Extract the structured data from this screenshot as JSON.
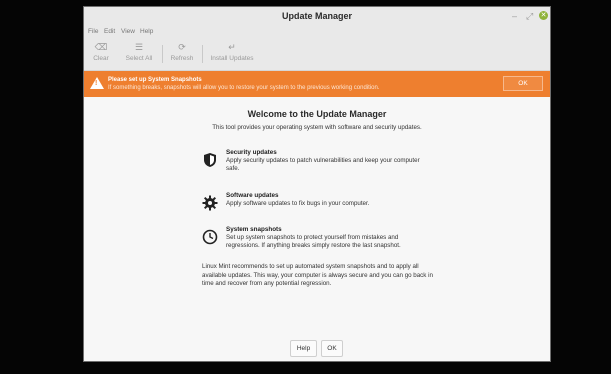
{
  "window": {
    "title": "Update Manager",
    "min_icon": "minimize-icon",
    "max_icon": "maximize-icon",
    "close_icon": "close-icon"
  },
  "menu": {
    "items": [
      "File",
      "Edit",
      "View",
      "Help"
    ]
  },
  "toolbar": {
    "clear": "Clear",
    "select_all": "Select All",
    "refresh": "Refresh",
    "install": "Install Updates"
  },
  "banner": {
    "title": "Please set up System Snapshots",
    "description": "If something breaks, snapshots will allow you to restore your system to the previous working condition.",
    "ok": "OK",
    "color": "#ee7f2f"
  },
  "welcome": {
    "title": "Welcome to the Update Manager",
    "subtitle": "This tool provides your operating system with software and security updates."
  },
  "features": [
    {
      "icon": "shield-icon",
      "title": "Security updates",
      "description": "Apply security updates to patch vulnerabilities and keep your computer safe."
    },
    {
      "icon": "gear-icon",
      "title": "Software updates",
      "description": "Apply software updates to fix bugs in your computer."
    },
    {
      "icon": "clock-icon",
      "title": "System snapshots",
      "description": "Set up system snapshots to protect yourself from mistakes and regressions. If anything breaks simply restore the last snapshot."
    }
  ],
  "recommendation": "Linux Mint recommends to set up automated system snapshots and to apply all available updates. This way, your computer is always secure and you can go back in time and recover from any potential regression.",
  "buttons": {
    "help": "Help",
    "ok": "OK"
  }
}
